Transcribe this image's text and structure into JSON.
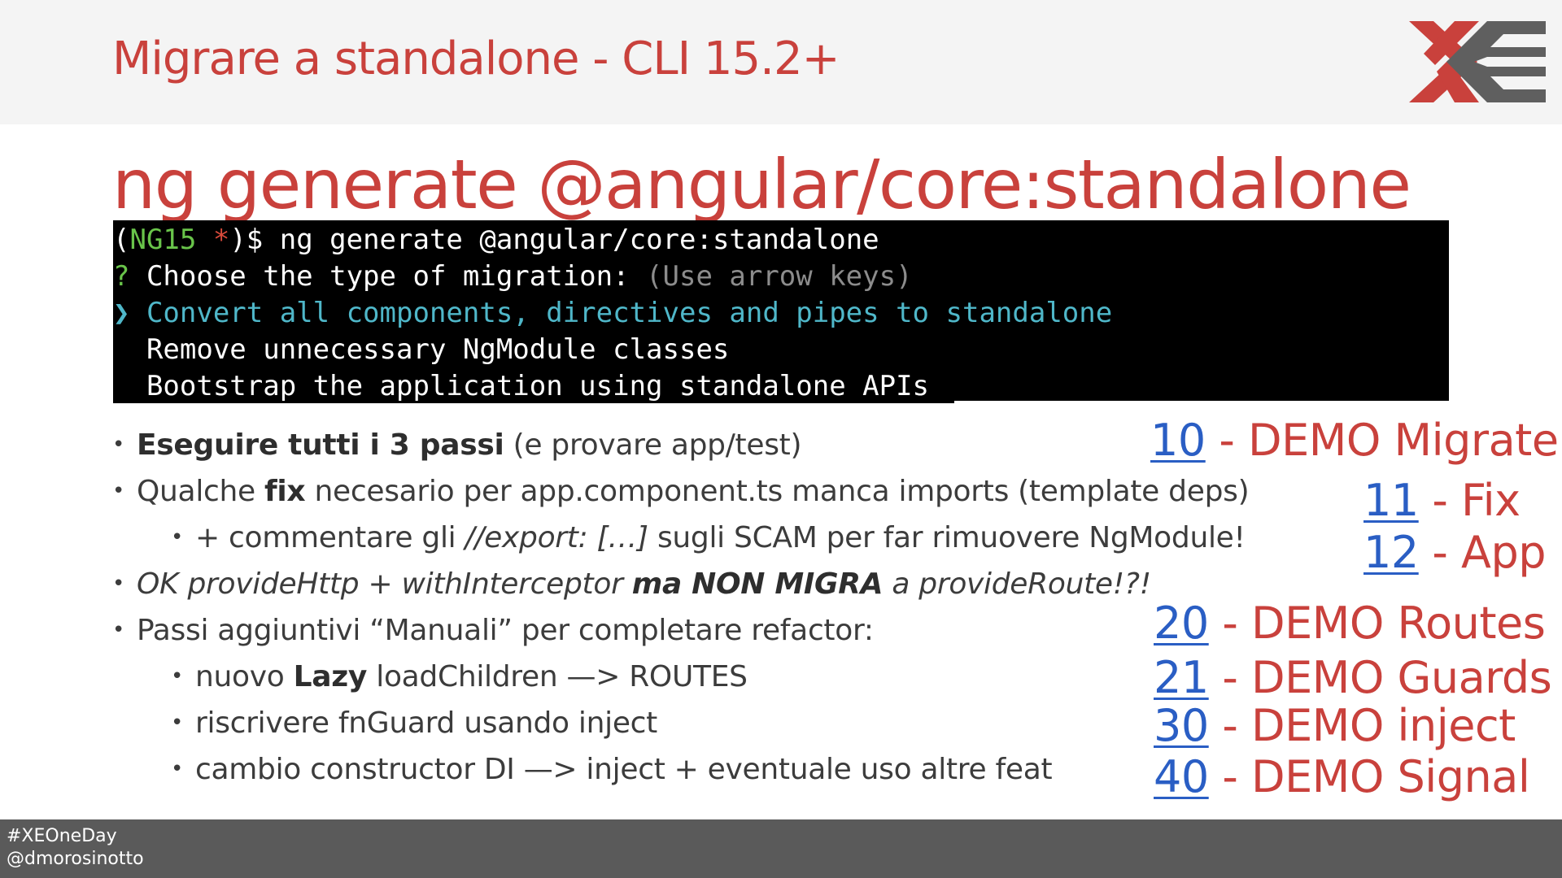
{
  "slide": {
    "title": "Migrare a standalone - CLI 15.2+",
    "heading": "ng generate @angular/core:standalone"
  },
  "terminal": {
    "prompt_open": "(",
    "prompt_branch": "NG15",
    "prompt_star": " *",
    "prompt_close": ")$ ng generate @angular/core:standalone",
    "question_mark": "?",
    "question_text": " Choose the type of migration: ",
    "question_hint": "(Use arrow keys)",
    "options": [
      {
        "marker": "❯",
        "label": " Convert all components, directives and pipes to standalone",
        "selected": true
      },
      {
        "marker": " ",
        "label": " Remove unnecessary NgModule classes",
        "selected": false
      },
      {
        "marker": " ",
        "label": " Bootstrap the application using standalone APIs",
        "selected": false
      }
    ]
  },
  "bullets": [
    {
      "dot": "•",
      "bold": "Eseguire tutti i 3 passi",
      "rest": " (e provare app/test)"
    },
    {
      "dot": "•",
      "pre": "Qualche ",
      "bold": "fix",
      "rest": " necesario per app.component.ts manca imports (template deps)"
    },
    {
      "dot": "•",
      "pre": "+ commentare gli ",
      "italic": "//export: […]",
      "rest": " sugli SCAM per far rimuovere NgModule!"
    },
    {
      "dot": "•",
      "italic1": "OK provideHttp + withInterceptor ",
      "bolditalic": "ma NON MIGRA",
      "italic2": " a provideRoute!?!"
    },
    {
      "dot": "•",
      "pre": "Passi aggiuntivi “Manuali” per completare refactor:"
    },
    {
      "dot": "•",
      "pre": "nuovo ",
      "bold": "Lazy",
      "rest": " loadChildren —> ROUTES"
    },
    {
      "dot": "•",
      "pre": "riscrivere fnGuard usando inject"
    },
    {
      "dot": "•",
      "pre": "cambio constructor DI —> inject + eventuale uso altre feat"
    }
  ],
  "demos": [
    {
      "num": "10",
      "label": " - DEMO Migrate"
    },
    {
      "num": "11",
      "label": " - Fix"
    },
    {
      "num": "12",
      "label": " - App"
    },
    {
      "num": "20",
      "label": " - DEMO Routes"
    },
    {
      "num": "21",
      "label": " - DEMO Guards"
    },
    {
      "num": "30",
      "label": " - DEMO inject"
    },
    {
      "num": "40",
      "label": " - DEMO Signal"
    }
  ],
  "footer": {
    "hashtag": "#XEOneDay",
    "handle": "@dmorosinotto"
  },
  "colors": {
    "accent_red": "#c9413c",
    "link_blue": "#2a5ec4",
    "logo_gray": "#5f5f5f"
  },
  "icons": {
    "logo": "xe-logo"
  }
}
